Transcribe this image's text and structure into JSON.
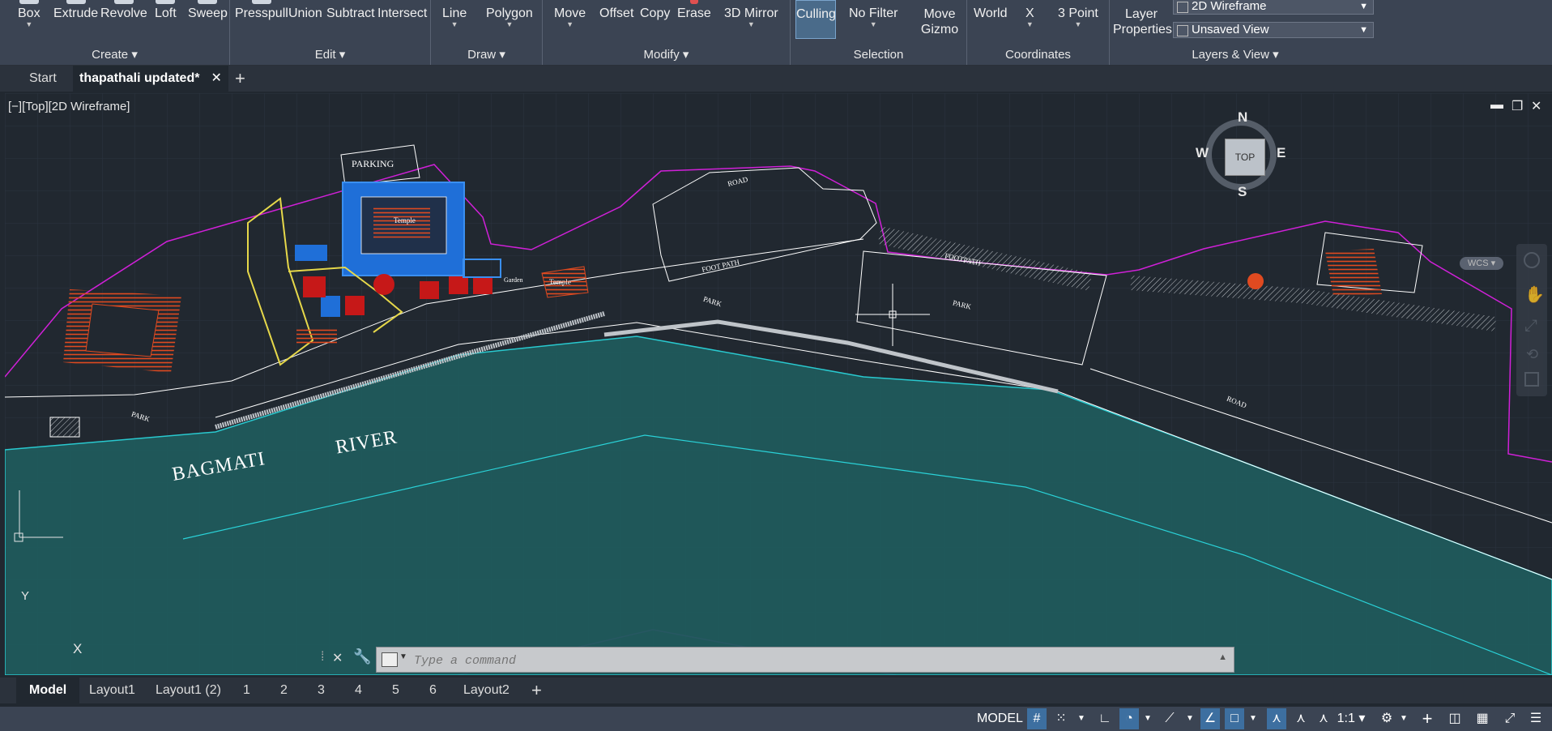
{
  "ribbon": {
    "create": {
      "title": "Create",
      "buttons": [
        "Box",
        "Extrude",
        "Revolve",
        "Loft",
        "Sweep"
      ]
    },
    "edit": {
      "title": "Edit",
      "buttons": [
        "Presspull",
        "Union",
        "Subtract",
        "Intersect"
      ]
    },
    "draw": {
      "title": "Draw",
      "buttons": [
        "Line",
        "Polygon"
      ]
    },
    "modify": {
      "title": "Modify",
      "buttons": [
        "Move",
        "Offset",
        "Copy",
        "Erase",
        "3D Mirror"
      ]
    },
    "selection": {
      "title": "Selection",
      "buttons": [
        "Culling",
        "No Filter",
        "Move Gizmo"
      ]
    },
    "coordinates": {
      "title": "Coordinates",
      "buttons": [
        "World",
        "X",
        "3 Point"
      ]
    },
    "layers": {
      "title": "Layers & View",
      "layer_properties": "Layer Properties",
      "visual_style": "2D Wireframe",
      "view": "Unsaved View"
    }
  },
  "doc_tabs": {
    "start": "Start",
    "active": "thapathali updated*"
  },
  "viewport": {
    "label": "[−][Top][2D Wireframe]",
    "drawing_text": {
      "parking": "PARKING",
      "temple": "Temple",
      "garden": "Garden",
      "temple2": "Temple",
      "road1": "ROAD",
      "footpath1": "FOOT PATH",
      "footpath2": "FOOTPATH",
      "park1": "PARK",
      "park2": "PARK",
      "park3": "PARK",
      "road2": "ROAD",
      "river_a": "BAGMATI",
      "river_b": "RIVER"
    },
    "viewcube": {
      "n": "N",
      "s": "S",
      "e": "E",
      "w": "W",
      "top": "TOP",
      "wcs": "WCS"
    },
    "ucs": {
      "x": "X",
      "y": "Y"
    }
  },
  "command": {
    "placeholder": "Type a command"
  },
  "layout_tabs": [
    "Model",
    "Layout1",
    "Layout1 (2)",
    "1",
    "2",
    "3",
    "4",
    "5",
    "6",
    "Layout2"
  ],
  "status": {
    "model": "MODEL",
    "scale": "1:1"
  }
}
